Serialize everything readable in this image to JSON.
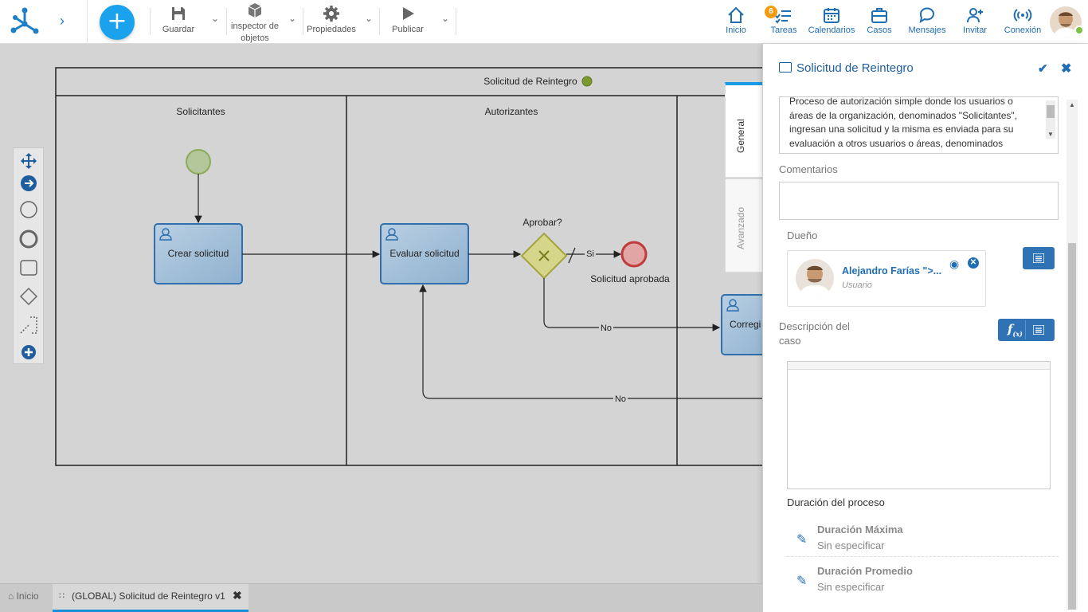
{
  "toolbar": {
    "save": "Guardar",
    "inspector_line1": "inspector de",
    "inspector_line2": "objetos",
    "properties": "Propiedades",
    "publish": "Publicar"
  },
  "nav": {
    "home": "Inicio",
    "tasks": "Tareas",
    "tasks_badge": "6",
    "calendars": "Calendarios",
    "cases": "Casos",
    "messages": "Mensajes",
    "invite": "Invitar",
    "connection": "Conexión"
  },
  "diagram": {
    "pool_title": "Solicitud de Reintegro",
    "lane1": "Solicitantes",
    "lane2": "Autorizantes",
    "task1": "Crear solicitud",
    "task2": "Evaluar solicitud",
    "task3": "Corregi",
    "gateway": "Aprobar?",
    "yes": "Si",
    "no1": "No",
    "no2": "No",
    "end_label": "Solicitud aprobada"
  },
  "tabs": {
    "general": "General",
    "advanced": "Avanzado"
  },
  "panel": {
    "title": "Solicitud de Reintegro",
    "description_lines": [
      "Proceso de autorización simple donde los usuarios o",
      "áreas de la organización, denominados \"Solicitantes\",",
      "ingresan una solicitud y la misma es enviada para su",
      "evaluación a otros usuarios o áreas, denominados"
    ],
    "comments_label": "Comentarios",
    "owner_label": "Dueño",
    "owner_name": "Alejandro Farías \">...",
    "owner_role": "Usuario",
    "case_desc_line1": "Descripción del",
    "case_desc_line2": "caso",
    "duration_title": "Duración del proceso",
    "max_label": "Duración Máxima",
    "max_value": "Sin especificar",
    "avg_label": "Duración Promedio",
    "avg_value": "Sin especificar"
  },
  "bottom": {
    "home": "Inicio",
    "tab": "(GLOBAL) Solicitud de Reintegro v1"
  }
}
